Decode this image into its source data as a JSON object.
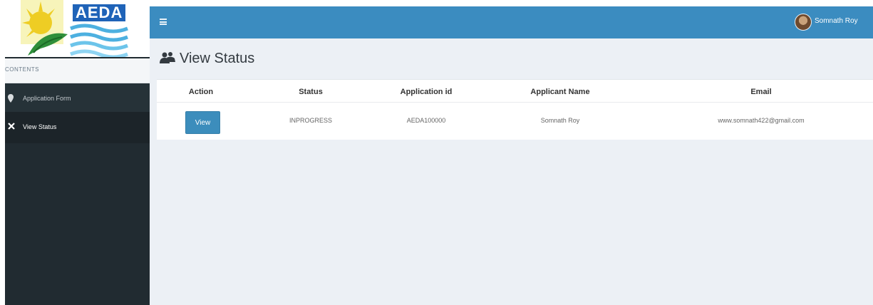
{
  "brand": {
    "logo_text": "AEDA"
  },
  "sidebar": {
    "section_label": "CONTENTS",
    "items": [
      {
        "label": "Application Form",
        "icon": "map-pin-icon"
      },
      {
        "label": "View Status",
        "icon": "crossed-tools-icon",
        "active": true
      }
    ]
  },
  "header": {
    "menu_icon": "hamburger-menu-icon",
    "user_name": "Somnath Roy"
  },
  "page": {
    "title": "View Status",
    "title_icon": "users-icon"
  },
  "table": {
    "columns": [
      "Action",
      "Status",
      "Application id",
      "Applicant Name",
      "Email"
    ],
    "rows": [
      {
        "action": "View",
        "status": "INPROGRESS",
        "application_id": "AEDA100000",
        "applicant_name": "Somnath Roy",
        "email": "www.somnath422@gmail.com"
      }
    ]
  },
  "colors": {
    "topbar": "#3b8cc0",
    "sidebar": "#212b31",
    "content_bg": "#ecf0f5",
    "button": "#3c8dbc"
  }
}
